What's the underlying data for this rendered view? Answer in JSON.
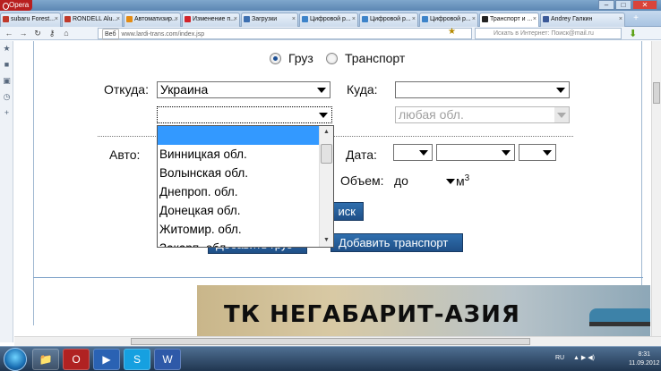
{
  "browser": {
    "app_button": "Opera",
    "window_controls": [
      "–",
      "□",
      "✕"
    ],
    "tabs": [
      {
        "label": "subaru Forest...",
        "color": "#c0392b"
      },
      {
        "label": "RONDELL Alu...",
        "color": "#c0392b"
      },
      {
        "label": "Автоматизир...",
        "color": "#e38b13"
      },
      {
        "label": "Изменение п...",
        "color": "#d2232a"
      },
      {
        "label": "Загрузки",
        "color": "#3d6fb0"
      },
      {
        "label": "Цифровой р...",
        "color": "#3d83c9"
      },
      {
        "label": "Цифровой р...",
        "color": "#3d83c9"
      },
      {
        "label": "Цифровой р...",
        "color": "#3d83c9"
      },
      {
        "label": "Транспорт и ...",
        "color": "#222222",
        "active": true
      },
      {
        "label": "Andrey Галкин",
        "color": "#3b5998"
      }
    ],
    "tab_add": "+",
    "url_badge": "Веб",
    "url": "www.lardi-trans.com/index.jsp",
    "search_placeholder": "Искать в Интернет: Поиск@mail.ru"
  },
  "form": {
    "radio_cargo": "Груз",
    "radio_transport": "Транспорт",
    "from_label": "Откуда:",
    "from_country": "Украина",
    "from_region": "",
    "to_label": "Куда:",
    "to_country": "",
    "to_region": "любая обл.",
    "auto_label": "Авто:",
    "date_label": "Дата:",
    "volume_label": "Объем:",
    "volume_prefix": "до",
    "volume_unit": "м",
    "volume_unit_sup": "3",
    "search_button": "иск",
    "add_cargo_button": "Добавить груз",
    "add_transport_button": "Добавить транспорт"
  },
  "region_dropdown": {
    "options": [
      "",
      "Винницкая обл.",
      "Волынская обл.",
      "Днепроп. обл.",
      "Донецкая обл.",
      "Житомир. обл.",
      "Закарп. обл."
    ],
    "selected_index": 0
  },
  "banner": {
    "title": "ТК НЕГАБАРИТ-АЗИЯ"
  },
  "taskbar": {
    "apps": [
      "📁",
      "O",
      "▶",
      "S",
      "W"
    ],
    "language": "RU",
    "time": "8:31",
    "date": "11.09.2012"
  }
}
